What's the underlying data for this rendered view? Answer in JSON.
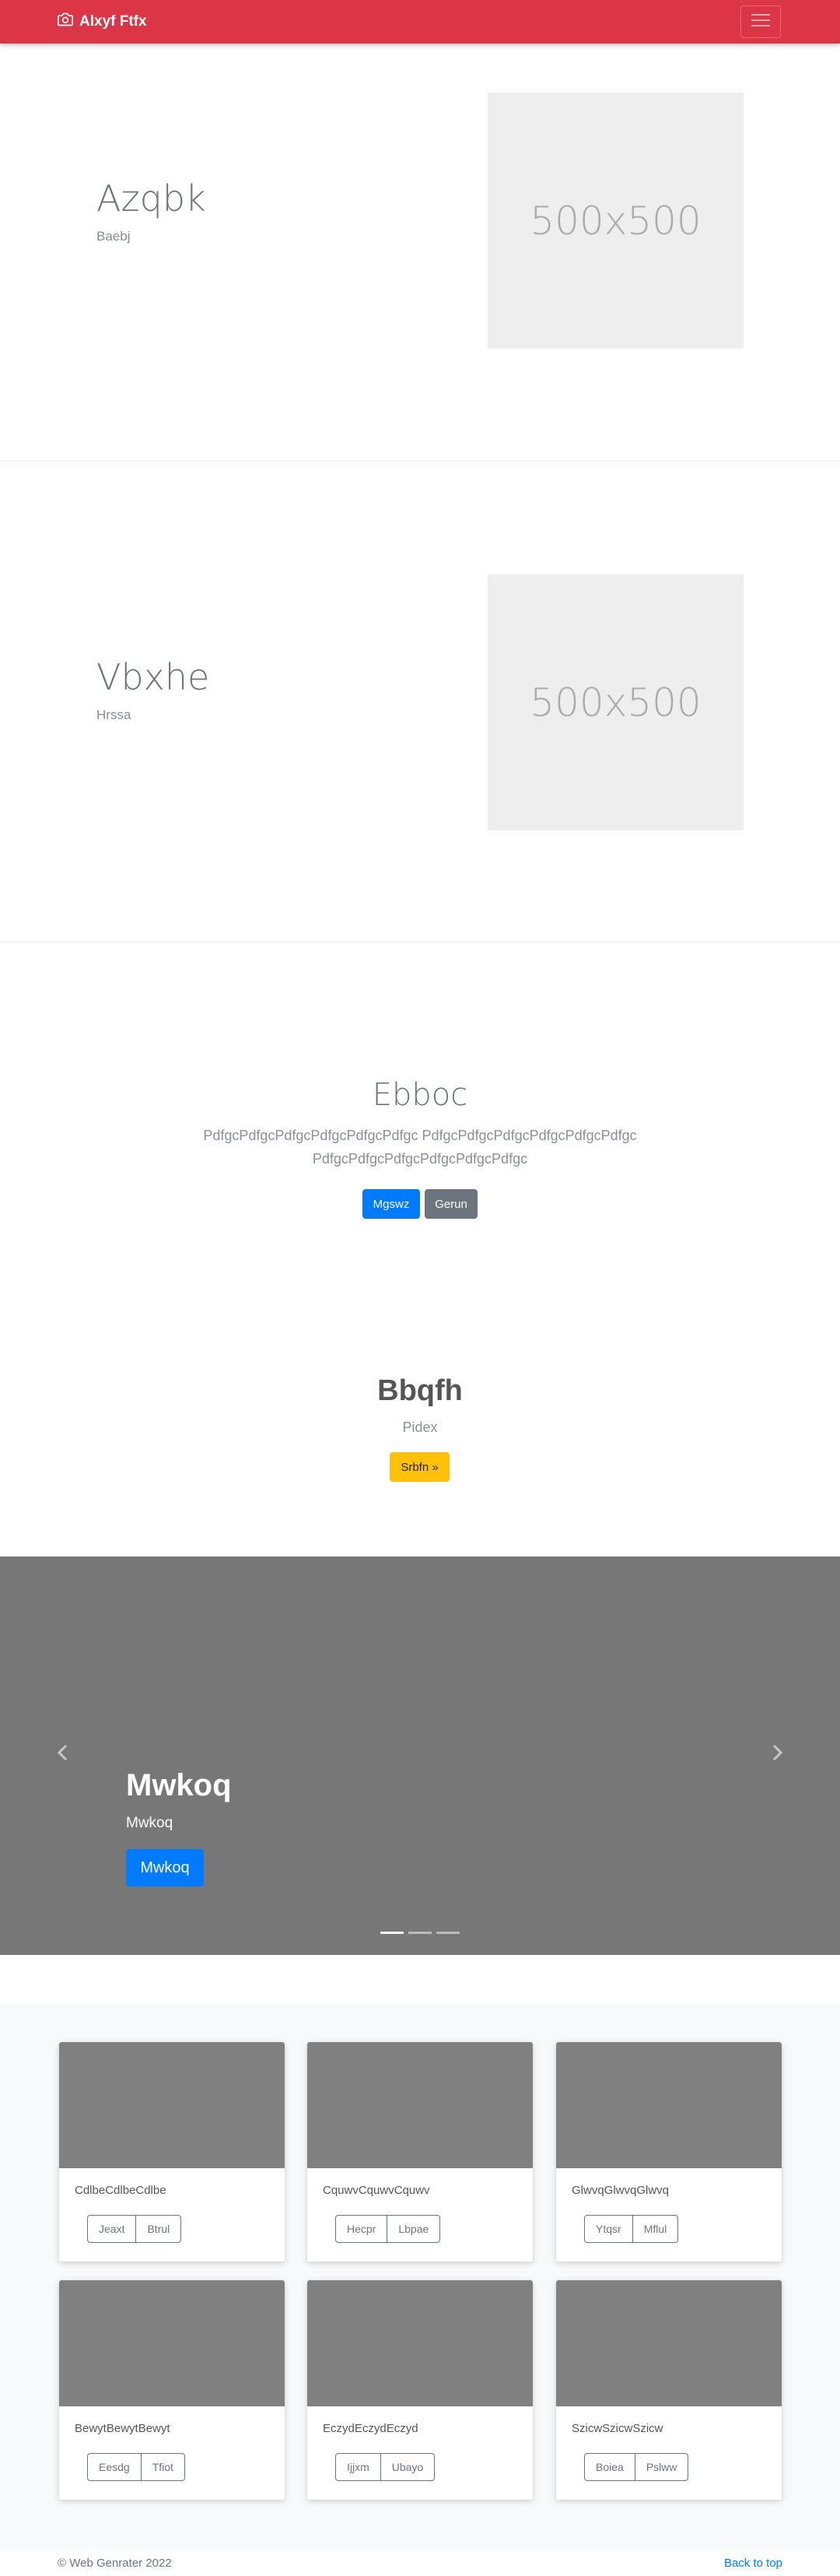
{
  "navbar": {
    "brand": "Alxyf Ftfx",
    "brand_icon": "camera-icon",
    "toggler_icon": "menu-icon",
    "color": "#dc3545"
  },
  "features": [
    {
      "heading": "Azqbk",
      "subtitle": "Baebj",
      "placeholder": "500x500"
    },
    {
      "heading": "Vbxhe",
      "subtitle": "Hrssa",
      "placeholder": "500x500"
    }
  ],
  "jumbotron": {
    "title": "Ebboc",
    "lead": "PdfgcPdfgcPdfgcPdfgcPdfgcPdfgc PdfgcPdfgcPdfgcPdfgcPdfgcPdfgc PdfgcPdfgcPdfgcPdfgcPdfgcPdfgc",
    "primary_button": "Mgswz",
    "secondary_button": "Gerun"
  },
  "cta": {
    "title": "Bbqfh",
    "subtitle": "Pidex",
    "button": "Srbfn »"
  },
  "carousel": {
    "caption_title": "Mwkoq",
    "caption_text": "Mwkoq",
    "button": "Mwkoq",
    "slides": 3,
    "active_slide": 1
  },
  "cards": [
    {
      "text": "CdlbeCdlbeCdlbe",
      "buttons": [
        "Jeaxt",
        "Btrul"
      ]
    },
    {
      "text": "CquwvCquwvCquwv",
      "buttons": [
        "Hecpr",
        "Lbpae"
      ]
    },
    {
      "text": "GlwvqGlwvqGlwvq",
      "buttons": [
        "Ytqsr",
        "Mflul"
      ]
    },
    {
      "text": "BewytBewytBewyt",
      "buttons": [
        "Eesdg",
        "Tfiot"
      ]
    },
    {
      "text": "EczydEczydEczyd",
      "buttons": [
        "Ijjxm",
        "Ubayo"
      ]
    },
    {
      "text": "SzicwSzicwSzicw",
      "buttons": [
        "Boiea",
        "Pslww"
      ]
    }
  ],
  "footer": {
    "copyright": "© Web Genrater 2022",
    "back_to_top": "Back to top"
  }
}
